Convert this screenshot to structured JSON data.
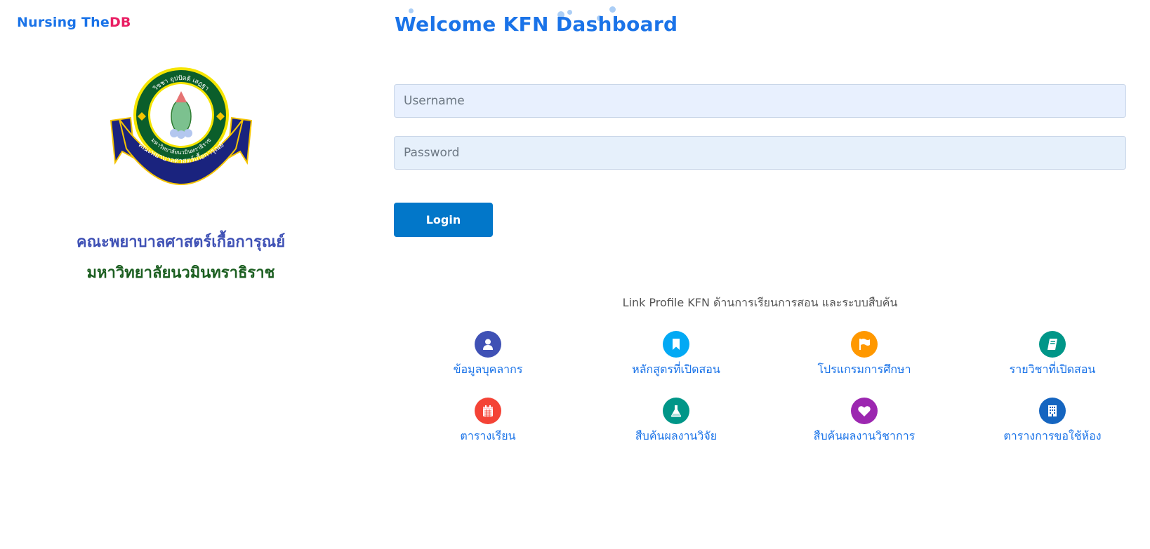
{
  "brand": {
    "prefix": "Nursing The",
    "suffix": "DB"
  },
  "seal": {
    "top_text": "วิชชา อุปปัตติ เสฏฐา",
    "ring_text": "มหาวิทยาลัยนวมินทราธิราช",
    "ribbon_text": "คณะพยาบาลศาสตร์เกื้อการุณย์"
  },
  "faculty": {
    "line1": "คณะพยาบาลศาสตร์เกื้อการุณย์",
    "line2": "มหาวิทยาลัยนวมินทราธิราช"
  },
  "welcome": "Welcome KFN Dashboard",
  "login": {
    "username_placeholder": "Username",
    "password_placeholder": "Password",
    "button_label": "Login"
  },
  "links": {
    "caption": "Link Profile KFN ด้านการเรียนการสอน และระบบสืบค้น",
    "items": [
      {
        "label": "ข้อมูลบุคลากร",
        "icon": "user-icon",
        "color": "#3f51b5"
      },
      {
        "label": "หลักสูตรที่เปิดสอน",
        "icon": "bookmark-icon",
        "color": "#03a9f4"
      },
      {
        "label": "โปรแกรมการศึกษา",
        "icon": "flag-icon",
        "color": "#ff9800"
      },
      {
        "label": "รายวิชาที่เปิดสอน",
        "icon": "book-icon",
        "color": "#009688"
      },
      {
        "label": "ตารางเรียน",
        "icon": "calendar-icon",
        "color": "#f44336"
      },
      {
        "label": "สืบค้นผลงานวิจัย",
        "icon": "flask-icon",
        "color": "#009688"
      },
      {
        "label": "สืบค้นผลงานวิชาการ",
        "icon": "heart-icon",
        "color": "#9c27b0"
      },
      {
        "label": "ตารางการขอใช้ห้อง",
        "icon": "building-icon",
        "color": "#1565c0"
      }
    ]
  },
  "colors": {
    "brand_blue": "#1a73e8",
    "brand_pink": "#e91e63",
    "login_button": "#0277c9",
    "faculty_line1": "#3f51b5",
    "faculty_line2": "#1b5e20"
  }
}
